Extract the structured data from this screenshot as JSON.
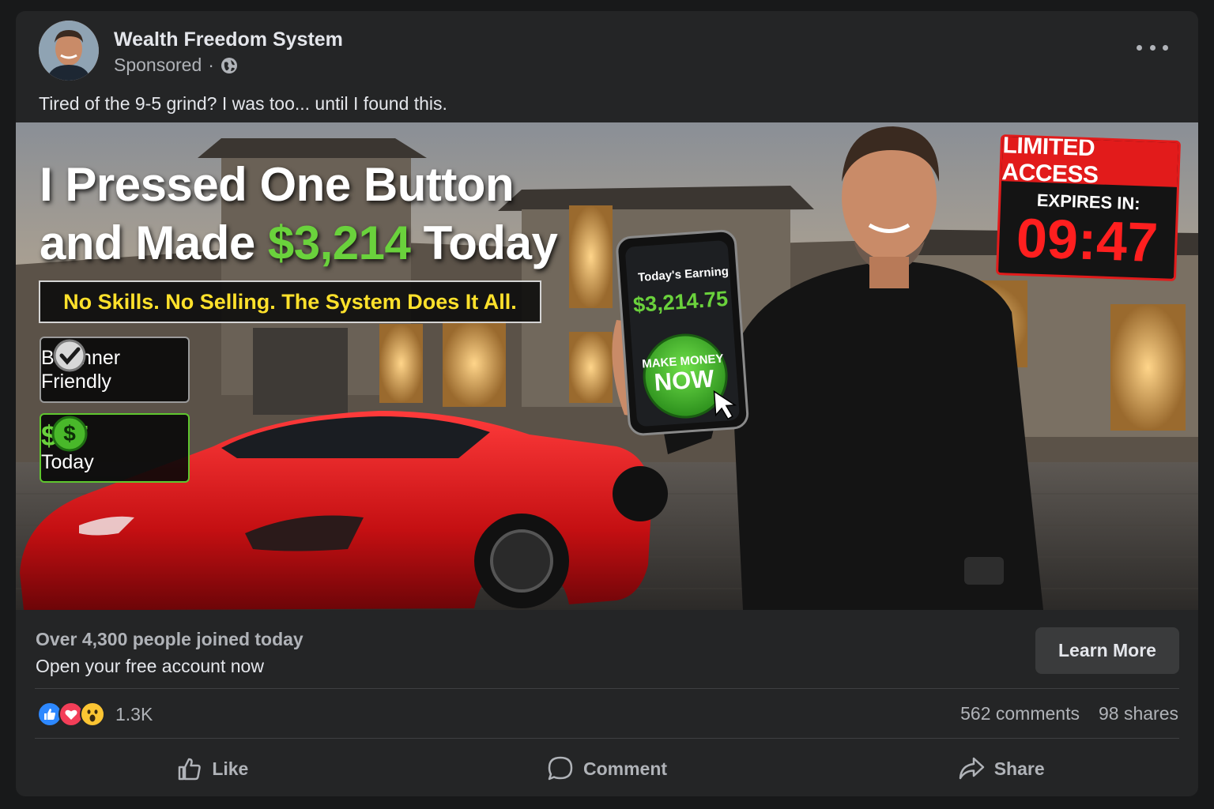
{
  "post": {
    "page_name": "Wealth Freedom System",
    "sponsored": "Sponsored",
    "separator": "·",
    "caption": "Tired of the 9-5 grind? I was too... until I found this."
  },
  "ad": {
    "headline_line1": "I Pressed One Button",
    "headline_line2_pre": "and Made ",
    "headline_amount": "$3,214",
    "headline_line2_post": " Today",
    "subheadline": "No Skills. No Selling. The System Does It All.",
    "badge_beginner_line1": "Beginner",
    "badge_beginner_line2": "Friendly",
    "badge_price_amount": "$67",
    "badge_price_label": "Today",
    "limited_title": "LIMITED ACCESS",
    "expires_label": "EXPIRES IN:",
    "countdown": "09:47",
    "phone_label": "Today's Earning",
    "phone_amount": "$3,214.75",
    "phone_button_line1": "MAKE MONEY",
    "phone_button_line2": "NOW"
  },
  "cta": {
    "line1": "Over 4,300 people joined today",
    "line2": "Open your free account now",
    "button": "Learn More"
  },
  "stats": {
    "reaction_count": "1.3K",
    "comments": "562 comments",
    "shares": "98 shares"
  },
  "actions": {
    "like": "Like",
    "comment": "Comment",
    "share": "Share"
  },
  "icons": [
    "avatar",
    "globe-icon",
    "more-icon",
    "check-icon",
    "dollar-icon",
    "like-reaction-icon",
    "love-reaction-icon",
    "wow-reaction-icon",
    "thumbs-up-icon",
    "comment-icon",
    "share-icon",
    "cursor-icon"
  ],
  "colors": {
    "accent_green": "#6ad23c",
    "highlight_yellow": "#ffe12b",
    "alert_red": "#e21b1b",
    "card_bg": "#242526"
  }
}
